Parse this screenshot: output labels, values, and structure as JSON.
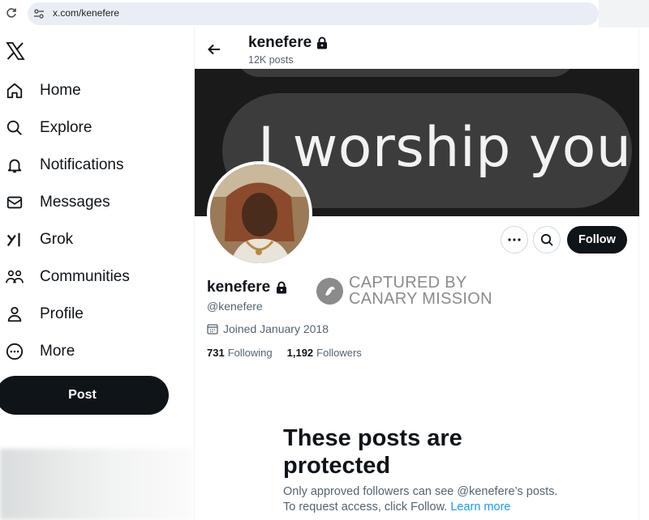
{
  "browser": {
    "url": "x.com/kenefere"
  },
  "nav": {
    "items": [
      {
        "label": "Home",
        "icon": "home-icon"
      },
      {
        "label": "Explore",
        "icon": "search-icon"
      },
      {
        "label": "Notifications",
        "icon": "bell-icon"
      },
      {
        "label": "Messages",
        "icon": "envelope-icon"
      },
      {
        "label": "Grok",
        "icon": "grok-icon"
      },
      {
        "label": "Communities",
        "icon": "communities-icon"
      },
      {
        "label": "Profile",
        "icon": "person-icon"
      },
      {
        "label": "More",
        "icon": "more-circle-icon"
      }
    ],
    "post_label": "Post"
  },
  "header": {
    "name": "kenefere",
    "posts": "12K posts"
  },
  "banner": {
    "text": "I worship you"
  },
  "profile": {
    "name": "kenefere",
    "handle": "@kenefere",
    "joined": "Joined January 2018",
    "following_count": "731",
    "following_label": "Following",
    "followers_count": "1,192",
    "followers_label": "Followers",
    "follow_label": "Follow"
  },
  "watermark": {
    "line1": "CAPTURED BY",
    "line2": "CANARY MISSION"
  },
  "protected": {
    "title": "These posts are protected",
    "desc_line1": "Only approved followers can see @kenefere’s posts.",
    "desc_line2_prefix": "To request access, click Follow.",
    "learn_more": "Learn more"
  },
  "colors": {
    "accent": "#1d9bf0",
    "dark": "#0f1419",
    "muted": "#536471"
  }
}
